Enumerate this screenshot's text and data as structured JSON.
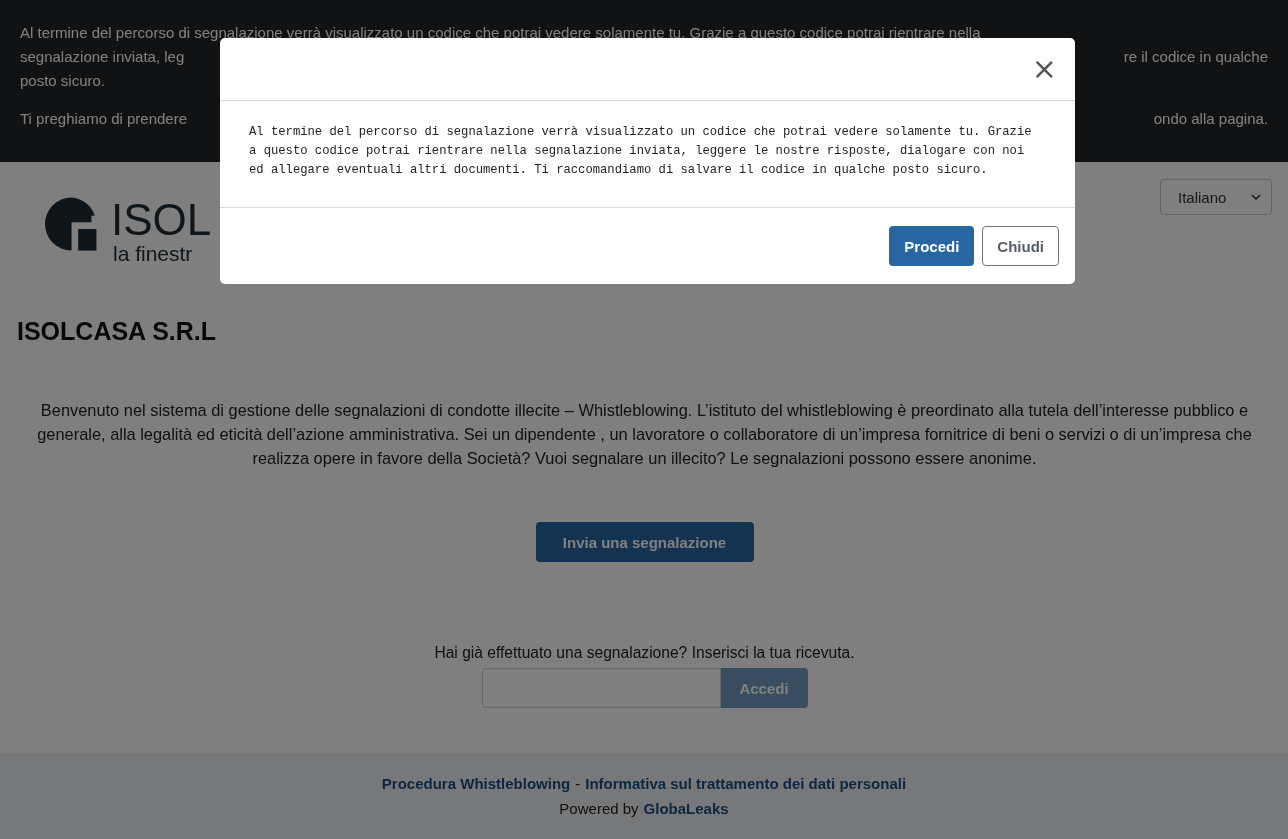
{
  "banner": {
    "lines": [
      {
        "left": "Al termine del percorso di segnalazione verrà visualizzato un codice che potrai vedere solamente tu. Grazie a questo codice potrai rientrare nella"
      },
      {
        "left": "segnalazione inviata, leg",
        "right": "re il codice in qualche"
      },
      {
        "left": "posto sicuro."
      },
      {
        "left": "Ti preghiamo di prendere",
        "right": "ondo alla pagina."
      }
    ]
  },
  "logo": {
    "name": "ISOL",
    "tagline": "la finestr"
  },
  "language": {
    "value": "Italiano"
  },
  "title": "ISOLCASA S.R.L",
  "intro": "Benvenuto nel sistema di gestione delle segnalazioni di condotte illecite – Whistleblowing. L’istituto del whistleblowing è preordinato alla tutela dell’interesse pubblico e generale, alla legalità ed eticità dell’azione amministrativa. Sei un dipendente , un lavoratore o collaboratore di un’impresa fornitrice di beni o servizi o di un’impresa che realizza opere in favore della Società? Vuoi segnalare un illecito? Le segnalazioni possono essere anonime.",
  "submit_button": "Invia una segnalazione",
  "receipt": {
    "prompt": "Hai già effettuato una segnalazione? Inserisci la tua ricevuta.",
    "button": "Accedi",
    "disabled": true
  },
  "footer": {
    "links": [
      "Procedura Whistleblowing",
      "Informativa sul trattamento dei dati personali"
    ],
    "separator": "-",
    "powered_by": "Powered by",
    "brand": "GlobaLeaks"
  },
  "modal": {
    "close": "×",
    "body": "Al termine del percorso di segnalazione verrà visualizzato un codice che potrai vedere solamente tu. Grazie a questo codice potrai rientrare nella segnalazione inviata, leggere le nostre risposte, dialogare con noi ed allegare eventuali altri documenti. Ti raccomandiamo di salvare il codice in qualche posto sicuro.",
    "buttons": [
      {
        "label": "Procedi",
        "kind": "primary"
      },
      {
        "label": "Chiudi",
        "kind": "secondary"
      }
    ]
  }
}
